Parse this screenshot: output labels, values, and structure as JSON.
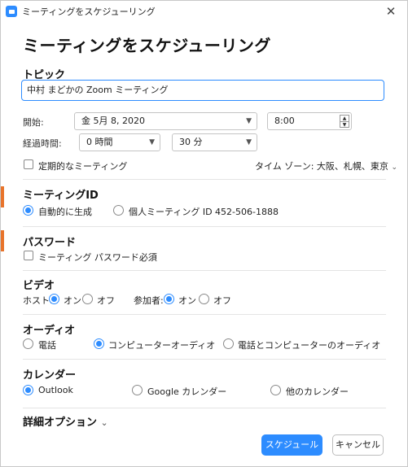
{
  "window": {
    "title": "ミーティングをスケジューリング",
    "close_glyph": "✕"
  },
  "heading": "ミーティングをスケジューリング",
  "topic": {
    "label": "トピック",
    "value": "中村 まどかの Zoom ミーティング"
  },
  "start": {
    "label": "開始:",
    "date": "金 5月 8, 2020",
    "time": "8:00"
  },
  "duration": {
    "label": "経過時間:",
    "hours": "0 時間",
    "minutes": "30 分"
  },
  "recurring": {
    "label": "定期的なミーティング",
    "checked": false
  },
  "timezone": {
    "label": "タイム ゾーン: 大阪、札幌、東京"
  },
  "meeting_id": {
    "title": "ミーティングID",
    "auto": "自動的に生成",
    "personal": "個人ミーティング ID 452-506-1888",
    "selected": "auto"
  },
  "password": {
    "title": "パスワード",
    "require_label": "ミーティング パスワード必須",
    "checked": false
  },
  "video": {
    "title": "ビデオ",
    "host_label": "ホスト:",
    "participants_label": "参加者:",
    "on": "オン",
    "off": "オフ",
    "host": "on",
    "participants": "on"
  },
  "audio": {
    "title": "オーディオ",
    "phone": "電話",
    "computer": "コンピューターオーディオ",
    "both": "電話とコンピューターのオーディオ",
    "selected": "computer"
  },
  "calendar": {
    "title": "カレンダー",
    "outlook": "Outlook",
    "google": "Google カレンダー",
    "other": "他のカレンダー",
    "selected": "outlook"
  },
  "advanced": {
    "label": "詳細オプション",
    "chevron": "⌄"
  },
  "buttons": {
    "schedule": "スケジュール",
    "cancel": "キャンセル"
  },
  "colors": {
    "accent": "#2d8cff",
    "left_strip": "#e8742b"
  }
}
